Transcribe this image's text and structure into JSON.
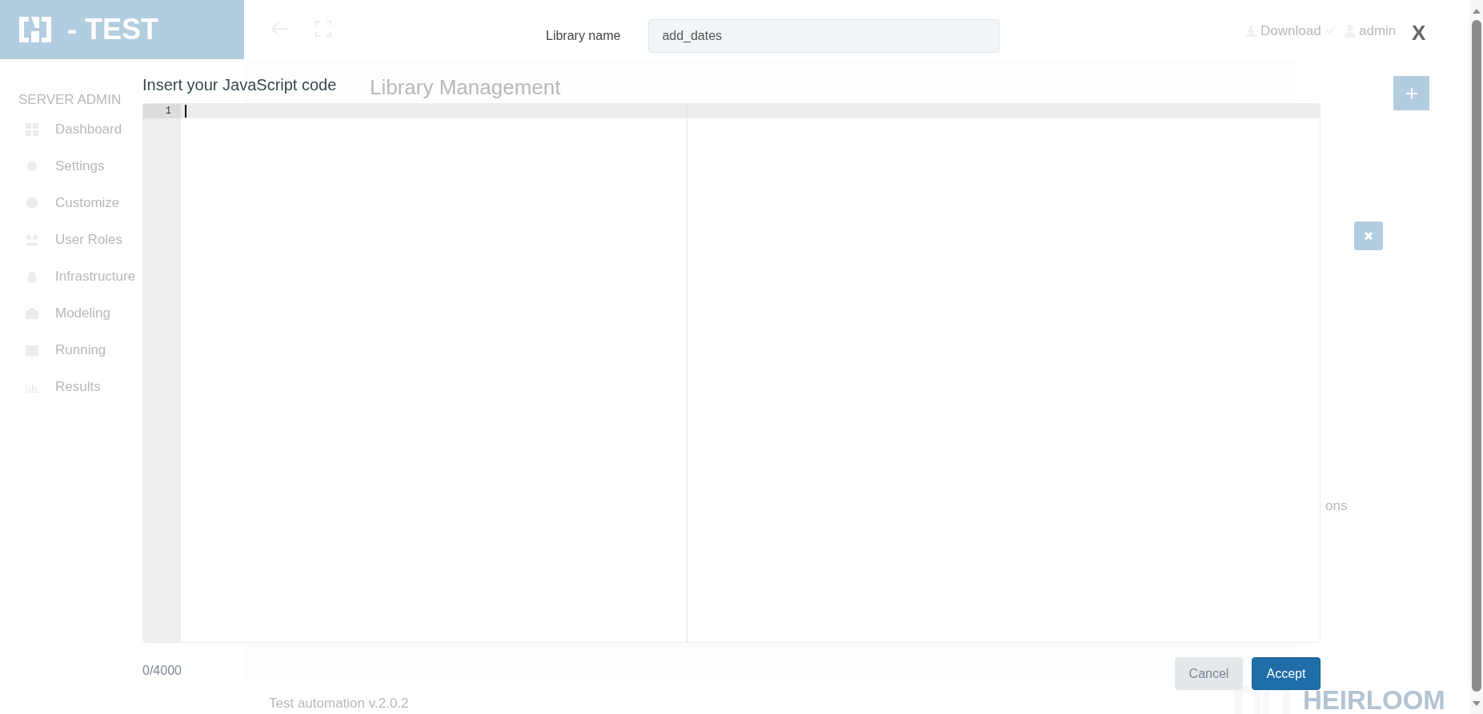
{
  "header": {
    "logo_text": "- TEST",
    "download": "Download",
    "user": "admin"
  },
  "sidebar": {
    "title": "SERVER ADMIN",
    "items": [
      {
        "label": "Dashboard"
      },
      {
        "label": "Settings"
      },
      {
        "label": "Customize"
      },
      {
        "label": "User Roles"
      },
      {
        "label": "Infrastructure"
      },
      {
        "label": "Modeling"
      },
      {
        "label": "Running"
      },
      {
        "label": "Results"
      }
    ]
  },
  "main": {
    "title": "Library Management",
    "fragment": "ons"
  },
  "footer": {
    "version": "Test automation v.2.0.2",
    "brand": "HEIRLOOM"
  },
  "dialog": {
    "close": "X",
    "name_label": "Library name",
    "name_value": "add_dates",
    "code_label": "Insert your JavaScript code",
    "line_numbers": [
      "1"
    ],
    "char_count": "0/4000",
    "buttons": [
      {
        "label": "Cancel",
        "kind": "secondary"
      },
      {
        "label": "Accept",
        "kind": "primary"
      }
    ]
  }
}
